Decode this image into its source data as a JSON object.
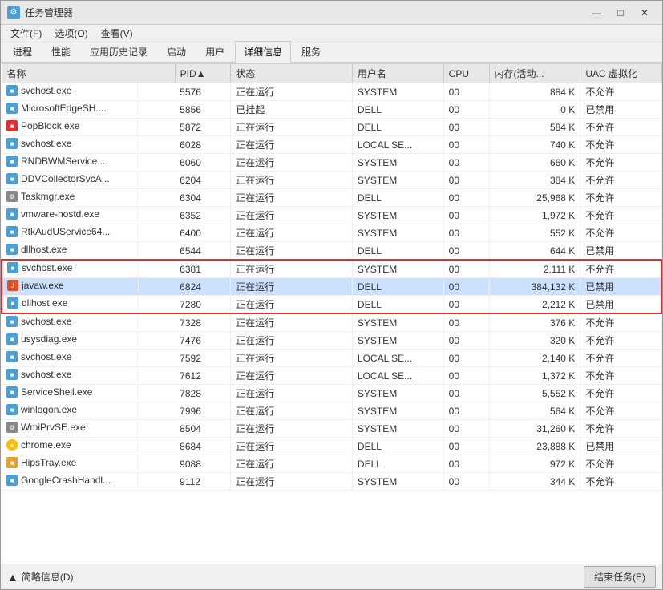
{
  "window": {
    "title": "任务管理器",
    "title_icon": "⚙",
    "controls": {
      "minimize": "—",
      "maximize": "□",
      "close": "✕"
    }
  },
  "menu": {
    "items": [
      "文件(F)",
      "选项(O)",
      "查看(V)"
    ]
  },
  "tabs": [
    {
      "label": "进程",
      "active": false
    },
    {
      "label": "性能",
      "active": false
    },
    {
      "label": "应用历史记录",
      "active": false
    },
    {
      "label": "启动",
      "active": false
    },
    {
      "label": "用户",
      "active": false
    },
    {
      "label": "详细信息",
      "active": true
    },
    {
      "label": "服务",
      "active": false
    }
  ],
  "table": {
    "headers": [
      "名称",
      "PID▲",
      "状态",
      "用户名",
      "CPU",
      "内存(活动...",
      "UAC 虚拟化"
    ],
    "rows": [
      {
        "name": "svchost.exe",
        "pid": "5576",
        "status": "正在运行",
        "user": "SYSTEM",
        "cpu": "00",
        "memory": "884 K",
        "uac": "不允许",
        "icon": "blue",
        "selected": false
      },
      {
        "name": "MicrosoftEdgeSH....",
        "pid": "5856",
        "status": "已挂起",
        "user": "DELL",
        "cpu": "00",
        "memory": "0 K",
        "uac": "已禁用",
        "icon": "blue",
        "selected": false
      },
      {
        "name": "PopBlock.exe",
        "pid": "5872",
        "status": "正在运行",
        "user": "DELL",
        "cpu": "00",
        "memory": "584 K",
        "uac": "不允许",
        "icon": "red",
        "selected": false
      },
      {
        "name": "svchost.exe",
        "pid": "6028",
        "status": "正在运行",
        "user": "LOCAL SE...",
        "cpu": "00",
        "memory": "740 K",
        "uac": "不允许",
        "icon": "blue",
        "selected": false
      },
      {
        "name": "RNDBWMService....",
        "pid": "6060",
        "status": "正在运行",
        "user": "SYSTEM",
        "cpu": "00",
        "memory": "660 K",
        "uac": "不允许",
        "icon": "blue",
        "selected": false
      },
      {
        "name": "DDVCollectorSvcA...",
        "pid": "6204",
        "status": "正在运行",
        "user": "SYSTEM",
        "cpu": "00",
        "memory": "384 K",
        "uac": "不允许",
        "icon": "blue",
        "selected": false
      },
      {
        "name": "Taskmgr.exe",
        "pid": "6304",
        "status": "正在运行",
        "user": "DELL",
        "cpu": "00",
        "memory": "25,968 K",
        "uac": "不允许",
        "icon": "gear",
        "selected": false
      },
      {
        "name": "vmware-hostd.exe",
        "pid": "6352",
        "status": "正在运行",
        "user": "SYSTEM",
        "cpu": "00",
        "memory": "1,972 K",
        "uac": "不允许",
        "icon": "blue",
        "selected": false
      },
      {
        "name": "RtkAudUService64...",
        "pid": "6400",
        "status": "正在运行",
        "user": "SYSTEM",
        "cpu": "00",
        "memory": "552 K",
        "uac": "不允许",
        "icon": "blue",
        "selected": false
      },
      {
        "name": "dllhost.exe",
        "pid": "6544",
        "status": "正在运行",
        "user": "DELL",
        "cpu": "00",
        "memory": "644 K",
        "uac": "已禁用",
        "icon": "blue",
        "selected": false
      },
      {
        "name": "svchost.exe",
        "pid": "6381",
        "status": "正在运行",
        "user": "SYSTEM",
        "cpu": "00",
        "memory": "2,111 K",
        "uac": "不允许",
        "icon": "blue",
        "selected": false,
        "red_top": true
      },
      {
        "name": "javaw.exe",
        "pid": "6824",
        "status": "正在运行",
        "user": "DELL",
        "cpu": "00",
        "memory": "384,132 K",
        "uac": "已禁用",
        "icon": "java",
        "selected": true
      },
      {
        "name": "dllhost.exe",
        "pid": "7280",
        "status": "正在运行",
        "user": "DELL",
        "cpu": "00",
        "memory": "2,212 K",
        "uac": "已禁用",
        "icon": "blue",
        "selected": false,
        "red_bottom": true
      },
      {
        "name": "svchost.exe",
        "pid": "7328",
        "status": "正在运行",
        "user": "SYSTEM",
        "cpu": "00",
        "memory": "376 K",
        "uac": "不允许",
        "icon": "blue",
        "selected": false
      },
      {
        "name": "usysdiag.exe",
        "pid": "7476",
        "status": "正在运行",
        "user": "SYSTEM",
        "cpu": "00",
        "memory": "320 K",
        "uac": "不允许",
        "icon": "blue",
        "selected": false
      },
      {
        "name": "svchost.exe",
        "pid": "7592",
        "status": "正在运行",
        "user": "LOCAL SE...",
        "cpu": "00",
        "memory": "2,140 K",
        "uac": "不允许",
        "icon": "blue",
        "selected": false
      },
      {
        "name": "svchost.exe",
        "pid": "7612",
        "status": "正在运行",
        "user": "LOCAL SE...",
        "cpu": "00",
        "memory": "1,372 K",
        "uac": "不允许",
        "icon": "blue",
        "selected": false
      },
      {
        "name": "ServiceShell.exe",
        "pid": "7828",
        "status": "正在运行",
        "user": "SYSTEM",
        "cpu": "00",
        "memory": "5,552 K",
        "uac": "不允许",
        "icon": "blue",
        "selected": false
      },
      {
        "name": "winlogon.exe",
        "pid": "7996",
        "status": "正在运行",
        "user": "SYSTEM",
        "cpu": "00",
        "memory": "564 K",
        "uac": "不允许",
        "icon": "blue",
        "selected": false
      },
      {
        "name": "WmiPrvSE.exe",
        "pid": "8504",
        "status": "正在运行",
        "user": "SYSTEM",
        "cpu": "00",
        "memory": "31,260 K",
        "uac": "不允许",
        "icon": "gear",
        "selected": false
      },
      {
        "name": "chrome.exe",
        "pid": "8684",
        "status": "正在运行",
        "user": "DELL",
        "cpu": "00",
        "memory": "23,888 K",
        "uac": "已禁用",
        "icon": "chrome",
        "selected": false
      },
      {
        "name": "HipsTray.exe",
        "pid": "9088",
        "status": "正在运行",
        "user": "DELL",
        "cpu": "00",
        "memory": "972 K",
        "uac": "不允许",
        "icon": "orange",
        "selected": false
      },
      {
        "name": "GoogleCrashHandl...",
        "pid": "9112",
        "status": "正在运行",
        "user": "SYSTEM",
        "cpu": "00",
        "memory": "344 K",
        "uac": "不允许",
        "icon": "blue",
        "selected": false
      }
    ]
  },
  "status_bar": {
    "details_label": "简略信息(D)",
    "end_task_label": "结束任务(E)"
  }
}
